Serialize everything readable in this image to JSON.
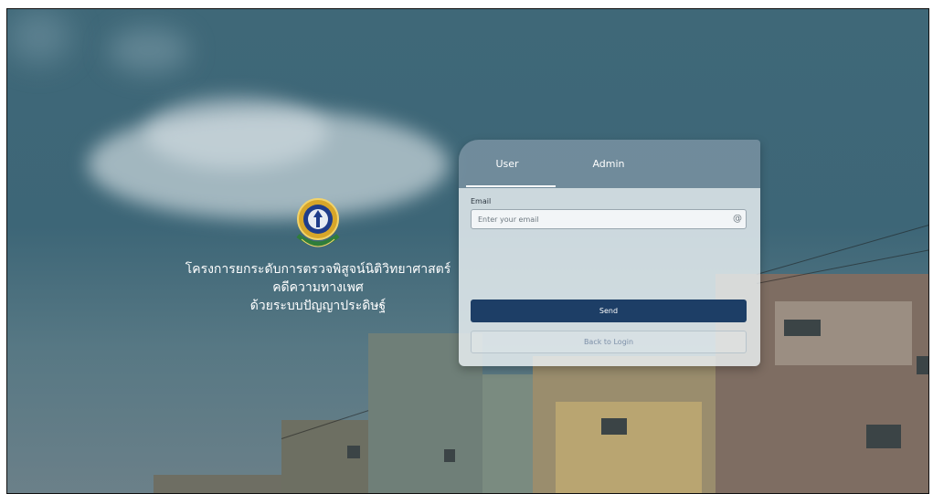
{
  "branding": {
    "logo_icon": "university-seal-icon",
    "title_lines": [
      "โครงการยกระดับการตรวจพิสูจน์นิติวิทยาศาสตร์",
      "คดีความทางเพศ",
      "ด้วยระบบปัญญาประดิษฐ์"
    ]
  },
  "tabs": [
    {
      "label": "User",
      "active": true
    },
    {
      "label": "Admin",
      "active": false
    }
  ],
  "form": {
    "email_label": "Email",
    "email_placeholder": "Enter your email",
    "email_value": "",
    "email_icon": "at-sign-icon",
    "send_label": "Send",
    "back_label": "Back to Login"
  },
  "colors": {
    "primary": "#1d3e66",
    "tab_bar": "#78919f",
    "background": "#3f6878"
  }
}
